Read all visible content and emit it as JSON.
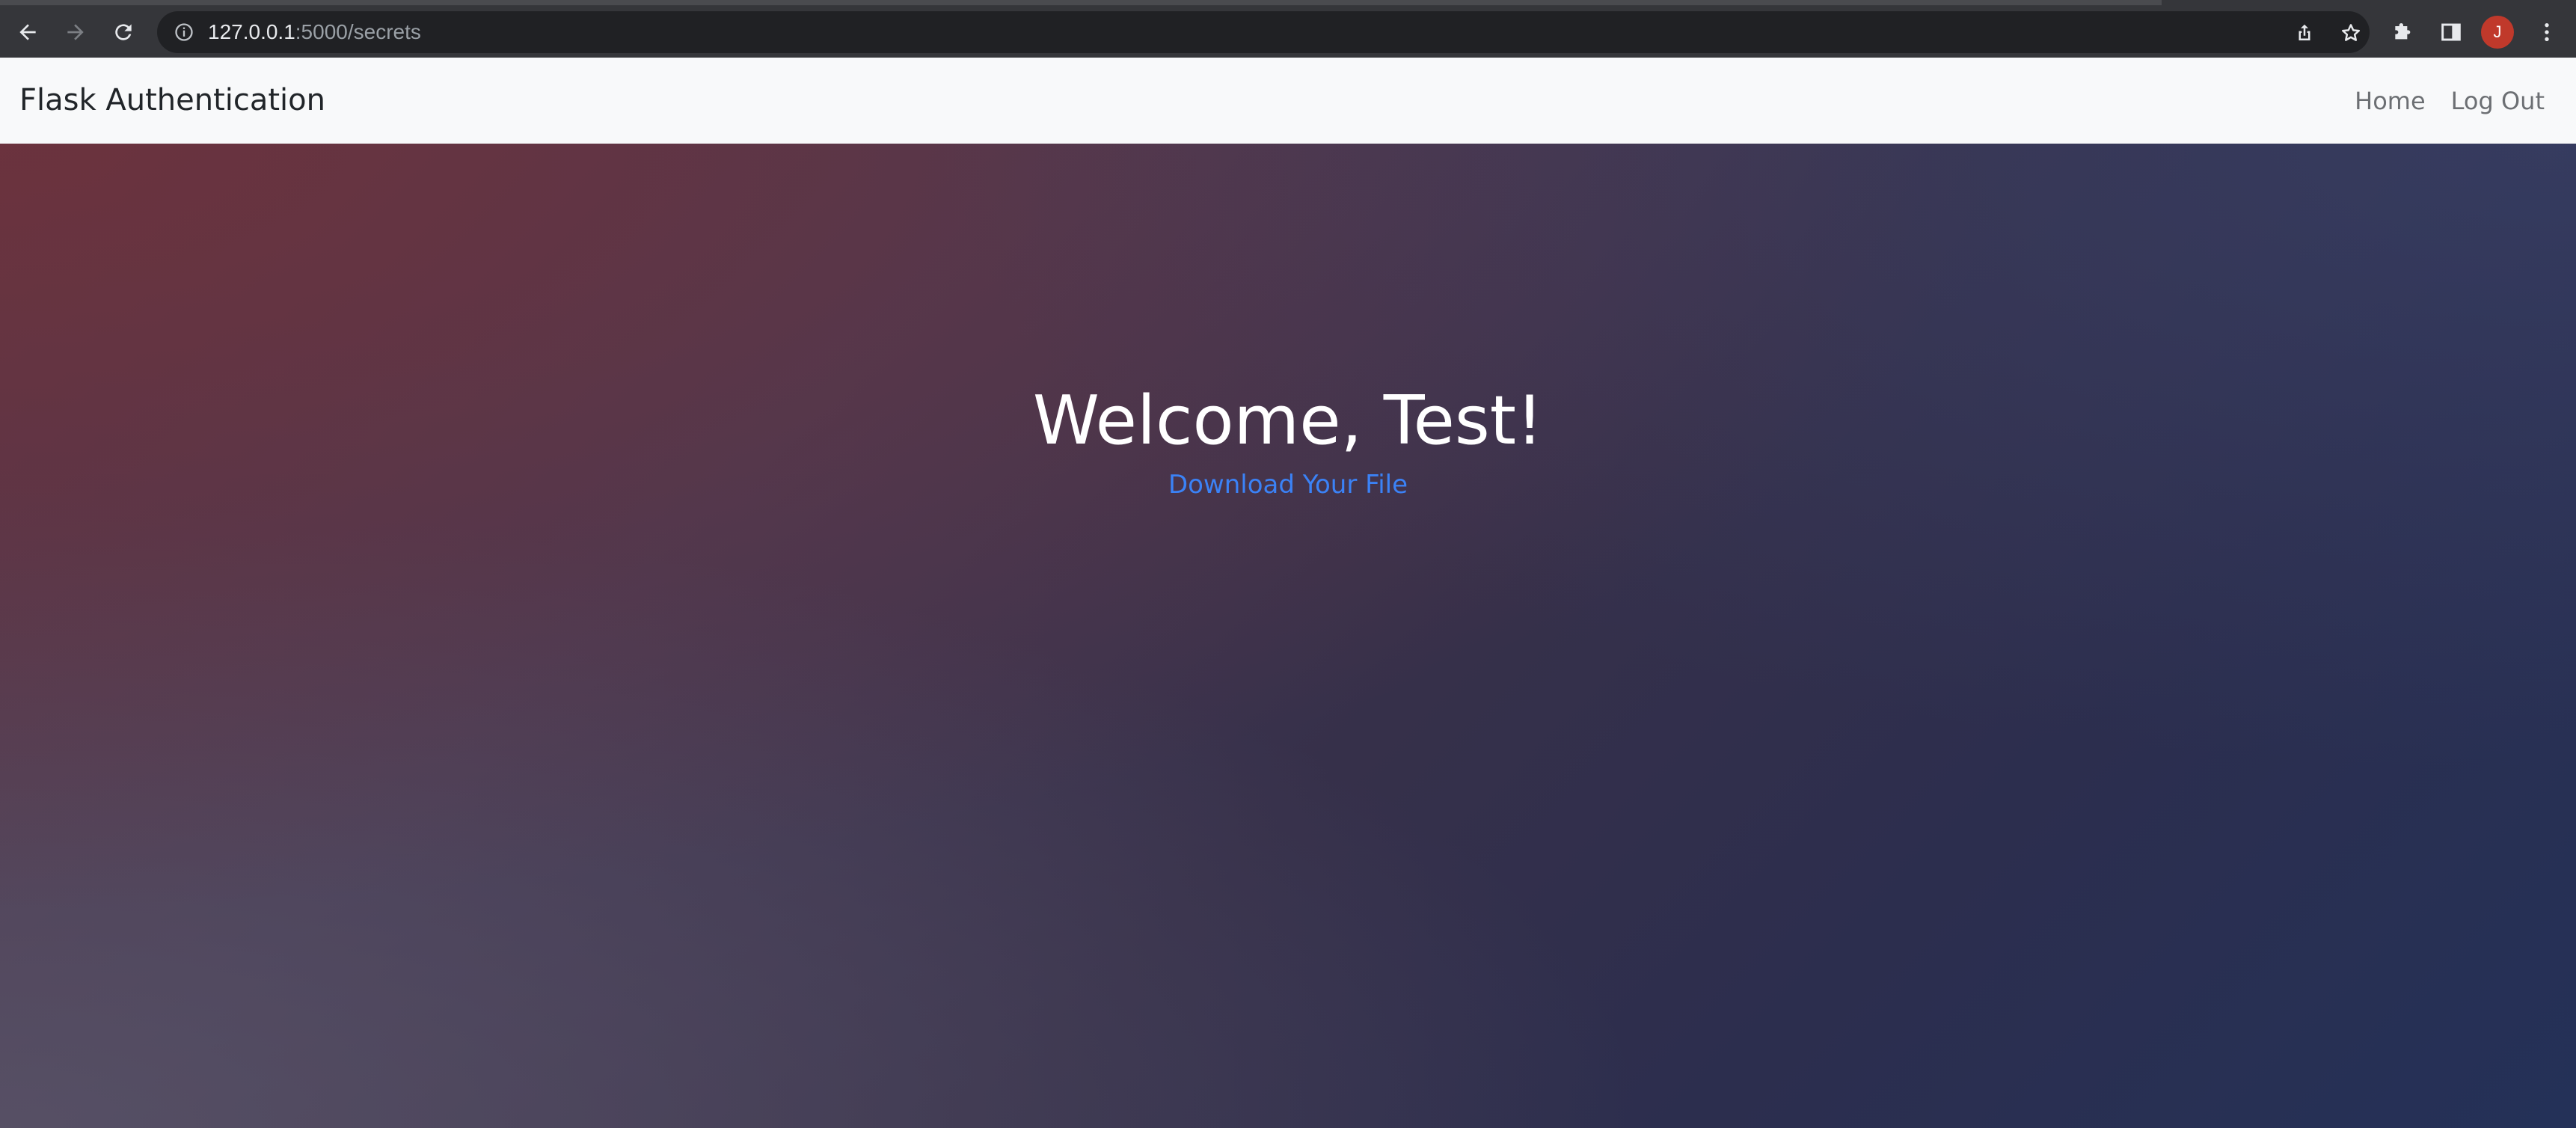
{
  "browser": {
    "url_host": "127.0.0.1",
    "url_path": ":5000/secrets",
    "profile_initial": "J",
    "icons": [
      "back-arrow-icon",
      "forward-arrow-icon",
      "reload-icon",
      "info-icon",
      "share-icon",
      "star-icon",
      "extensions-icon",
      "side-panel-icon",
      "kebab-menu-icon"
    ]
  },
  "navbar": {
    "brand": "Flask Authentication",
    "links": [
      "Home",
      "Log Out"
    ]
  },
  "main": {
    "title": "Welcome, Test!",
    "download_link": "Download Your File"
  },
  "colors": {
    "link": "#3b82f6",
    "navbar_bg": "#f8f9fa",
    "avatar": "#c0392b"
  }
}
